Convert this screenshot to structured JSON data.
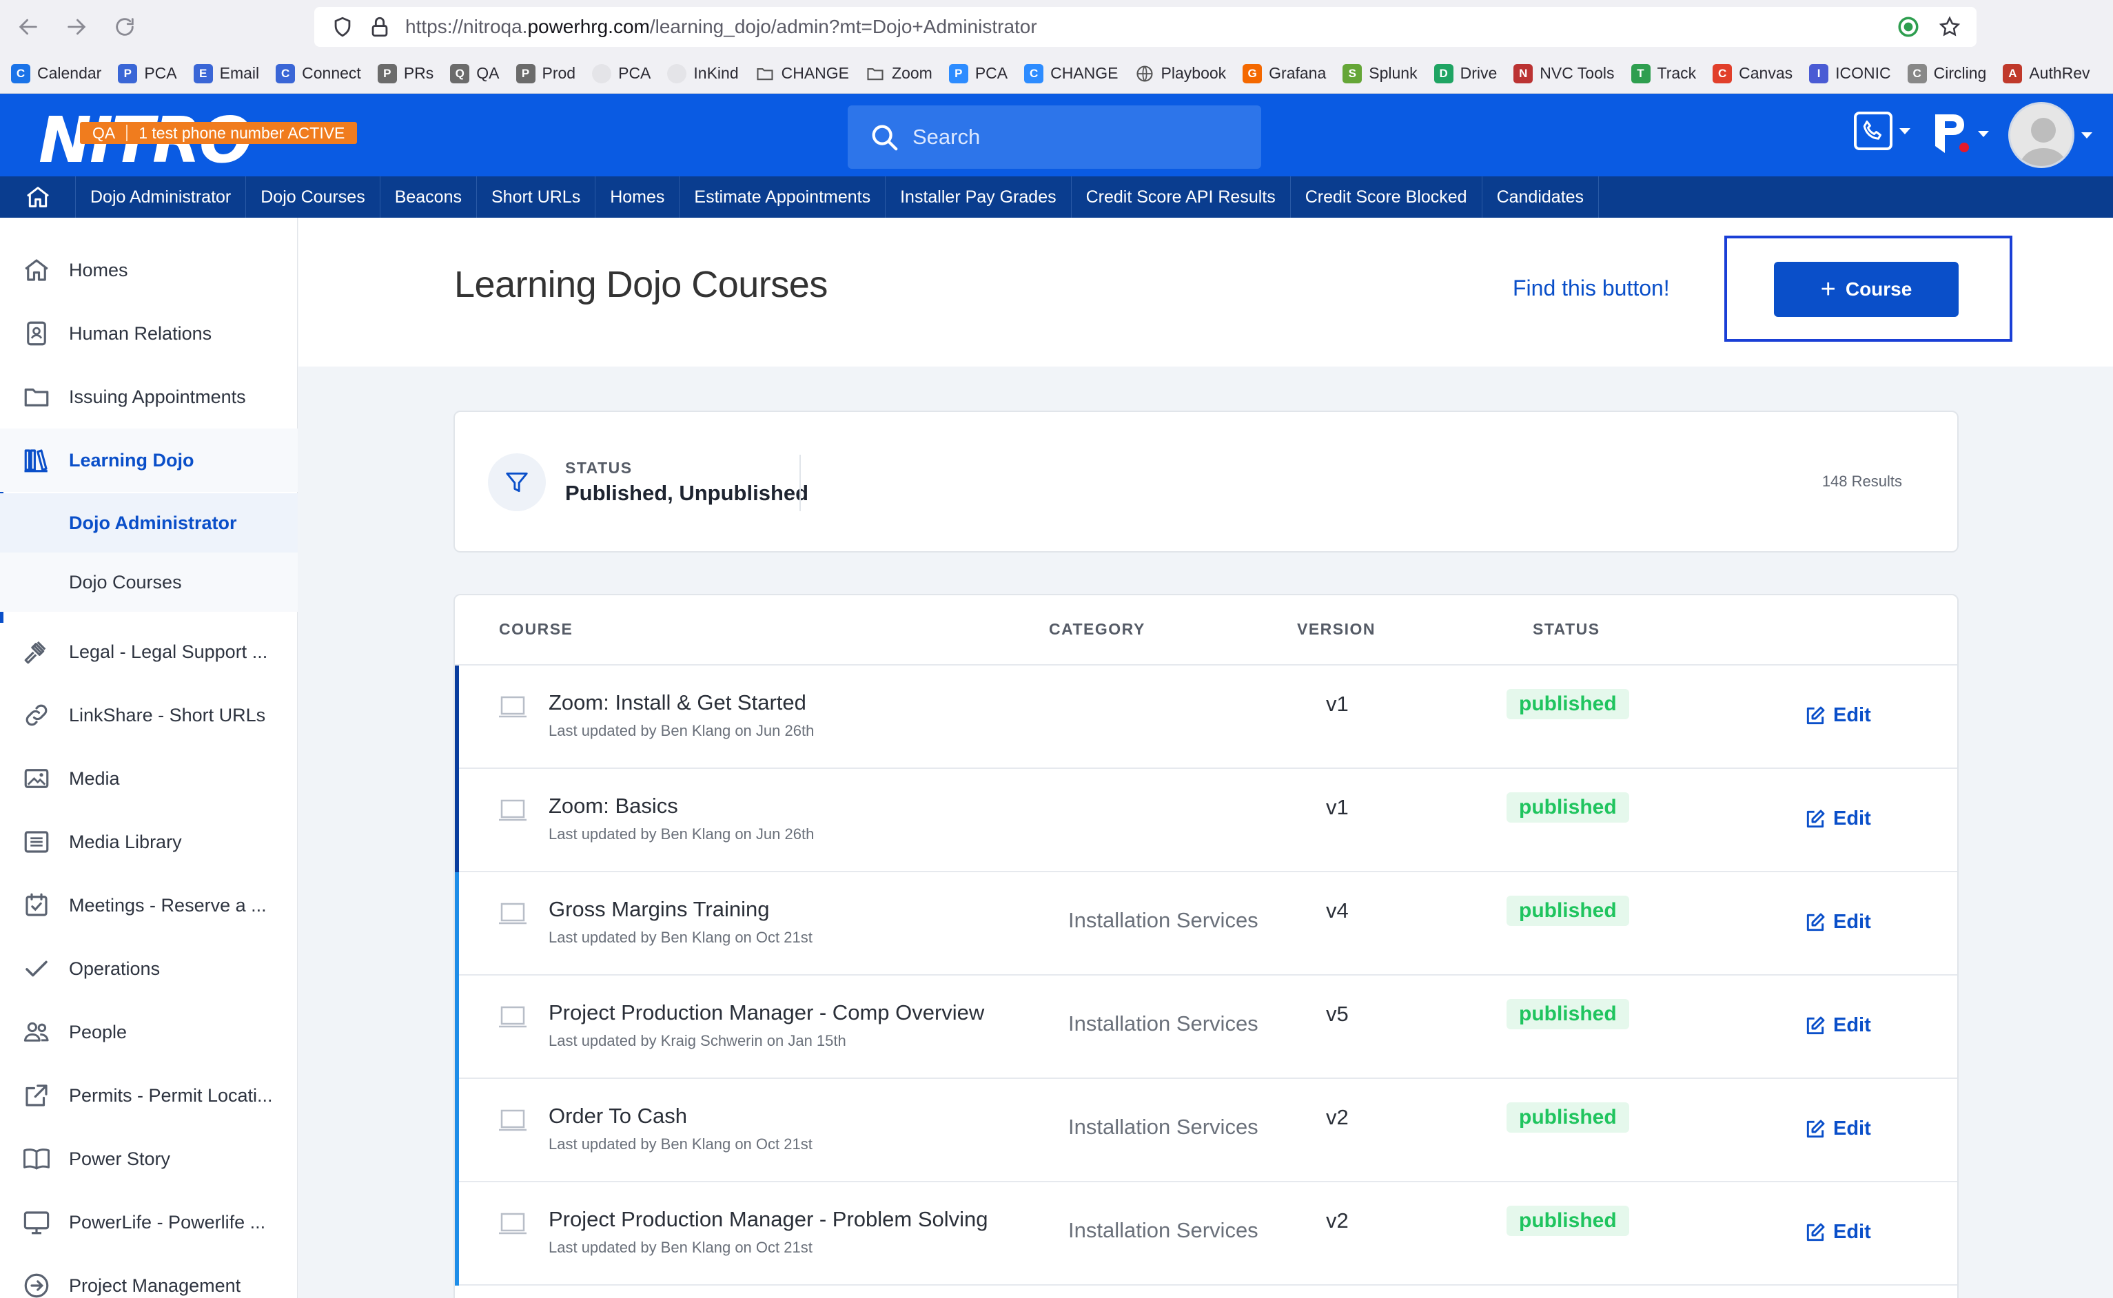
{
  "browser": {
    "url_prefix": "https://nitroqa.",
    "url_domain": "powerhrg.com",
    "url_path": "/learning_dojo/admin?mt=Dojo+Administrator",
    "bookmarks": [
      {
        "label": "Calendar",
        "icon": "calendar-icon",
        "color": "#1a73e8"
      },
      {
        "label": "PCA",
        "icon": "pca-icon",
        "color": "#3a66d6"
      },
      {
        "label": "Email",
        "icon": "email-icon",
        "color": "#3a66d6"
      },
      {
        "label": "Connect",
        "icon": "connect-icon",
        "color": "#3a66d6"
      },
      {
        "label": "PRs",
        "icon": "prs-icon",
        "color": "#6b6b6b"
      },
      {
        "label": "QA",
        "icon": "qa-icon",
        "color": "#6b6b6b"
      },
      {
        "label": "Prod",
        "icon": "prod-icon",
        "color": "#6b6b6b"
      },
      {
        "label": "PCA",
        "icon": "github-icon",
        "color": "#222222"
      },
      {
        "label": "InKind",
        "icon": "github-icon",
        "color": "#222222"
      },
      {
        "label": "CHANGE",
        "icon": "folder-icon",
        "color": "#555555"
      },
      {
        "label": "Zoom",
        "icon": "folder-icon",
        "color": "#555555"
      },
      {
        "label": "PCA",
        "icon": "zoom-icon",
        "color": "#2d8cff"
      },
      {
        "label": "CHANGE",
        "icon": "zoom-icon",
        "color": "#2d8cff"
      },
      {
        "label": "Playbook",
        "icon": "globe-icon",
        "color": "#555555"
      },
      {
        "label": "Grafana",
        "icon": "grafana-icon",
        "color": "#f46800"
      },
      {
        "label": "Splunk",
        "icon": "splunk-icon",
        "color": "#65a637"
      },
      {
        "label": "Drive",
        "icon": "drive-icon",
        "color": "#1fa463"
      },
      {
        "label": "NVC Tools",
        "icon": "nvc-icon",
        "color": "#b33"
      },
      {
        "label": "Track",
        "icon": "track-icon",
        "color": "#2e9e4f"
      },
      {
        "label": "Canvas",
        "icon": "canvas-icon",
        "color": "#e13f2b"
      },
      {
        "label": "ICONIC",
        "icon": "iconic-icon",
        "color": "#4a5bd4"
      },
      {
        "label": "Circling",
        "icon": "circling-icon",
        "color": "#888888"
      },
      {
        "label": "AuthRev",
        "icon": "authrev-icon",
        "color": "#c0392b"
      }
    ]
  },
  "header": {
    "logo": "NITRO",
    "env_label": "QA",
    "env_message": "1 test phone number ACTIVE",
    "search_placeholder": "Search"
  },
  "subnav": {
    "tabs": [
      "Dojo Administrator",
      "Dojo Courses",
      "Beacons",
      "Short URLs",
      "Homes",
      "Estimate Appointments",
      "Installer Pay Grades",
      "Credit Score API Results",
      "Credit Score Blocked",
      "Candidates"
    ]
  },
  "sidebar": {
    "items": [
      {
        "label": "Homes",
        "icon": "house-icon"
      },
      {
        "label": "Human Relations",
        "icon": "id-card-icon"
      },
      {
        "label": "Issuing Appointments",
        "icon": "folder-icon"
      },
      {
        "label": "Learning Dojo",
        "icon": "books-icon"
      },
      {
        "label": "Legal - Legal Support ...",
        "icon": "gavel-icon"
      },
      {
        "label": "LinkShare - Short URLs",
        "icon": "link-icon"
      },
      {
        "label": "Media",
        "icon": "image-icon"
      },
      {
        "label": "Media Library",
        "icon": "list-icon"
      },
      {
        "label": "Meetings - Reserve a ...",
        "icon": "calendar-check-icon"
      },
      {
        "label": "Operations",
        "icon": "check-icon"
      },
      {
        "label": "People",
        "icon": "people-icon"
      },
      {
        "label": "Permits - Permit Locati...",
        "icon": "external-link-icon"
      },
      {
        "label": "Power Story",
        "icon": "book-open-icon"
      },
      {
        "label": "PowerLife - Powerlife ...",
        "icon": "monitor-icon"
      },
      {
        "label": "Project Management",
        "icon": "arrow-circle-icon"
      }
    ],
    "subitems": [
      "Dojo Administrator",
      "Dojo Courses"
    ]
  },
  "page": {
    "title": "Learning Dojo Courses",
    "find_link": "Find this button!",
    "new_course_label": "Course"
  },
  "filter": {
    "label": "STATUS",
    "value": "Published, Unpublished",
    "results": "148 Results"
  },
  "table": {
    "headers": {
      "course": "COURSE",
      "category": "CATEGORY",
      "version": "VERSION",
      "status": "STATUS"
    },
    "edit_label": "Edit",
    "rows": [
      {
        "name": "Zoom: Install & Get Started",
        "meta": "Last updated by Ben Klang on Jun 26th",
        "category": "",
        "version": "v1",
        "status": "published",
        "accent": "#0a3d9e"
      },
      {
        "name": "Zoom: Basics",
        "meta": "Last updated by Ben Klang on Jun 26th",
        "category": "",
        "version": "v1",
        "status": "published",
        "accent": "#0a3d9e"
      },
      {
        "name": "Gross Margins Training",
        "meta": "Last updated by Ben Klang on Oct 21st",
        "category": "Installation Services",
        "version": "v4",
        "status": "published",
        "accent": "#1e8de8"
      },
      {
        "name": "Project Production Manager - Comp Overview",
        "meta": "Last updated by Kraig Schwerin on Jan 15th",
        "category": "Installation Services",
        "version": "v5",
        "status": "published",
        "accent": "#1e8de8"
      },
      {
        "name": "Order To Cash",
        "meta": "Last updated by Ben Klang on Oct 21st",
        "category": "Installation Services",
        "version": "v2",
        "status": "published",
        "accent": "#1e8de8"
      },
      {
        "name": "Project Production Manager - Problem Solving",
        "meta": "Last updated by Ben Klang on Oct 21st",
        "category": "Installation Services",
        "version": "v2",
        "status": "published",
        "accent": "#1e8de8"
      }
    ]
  }
}
